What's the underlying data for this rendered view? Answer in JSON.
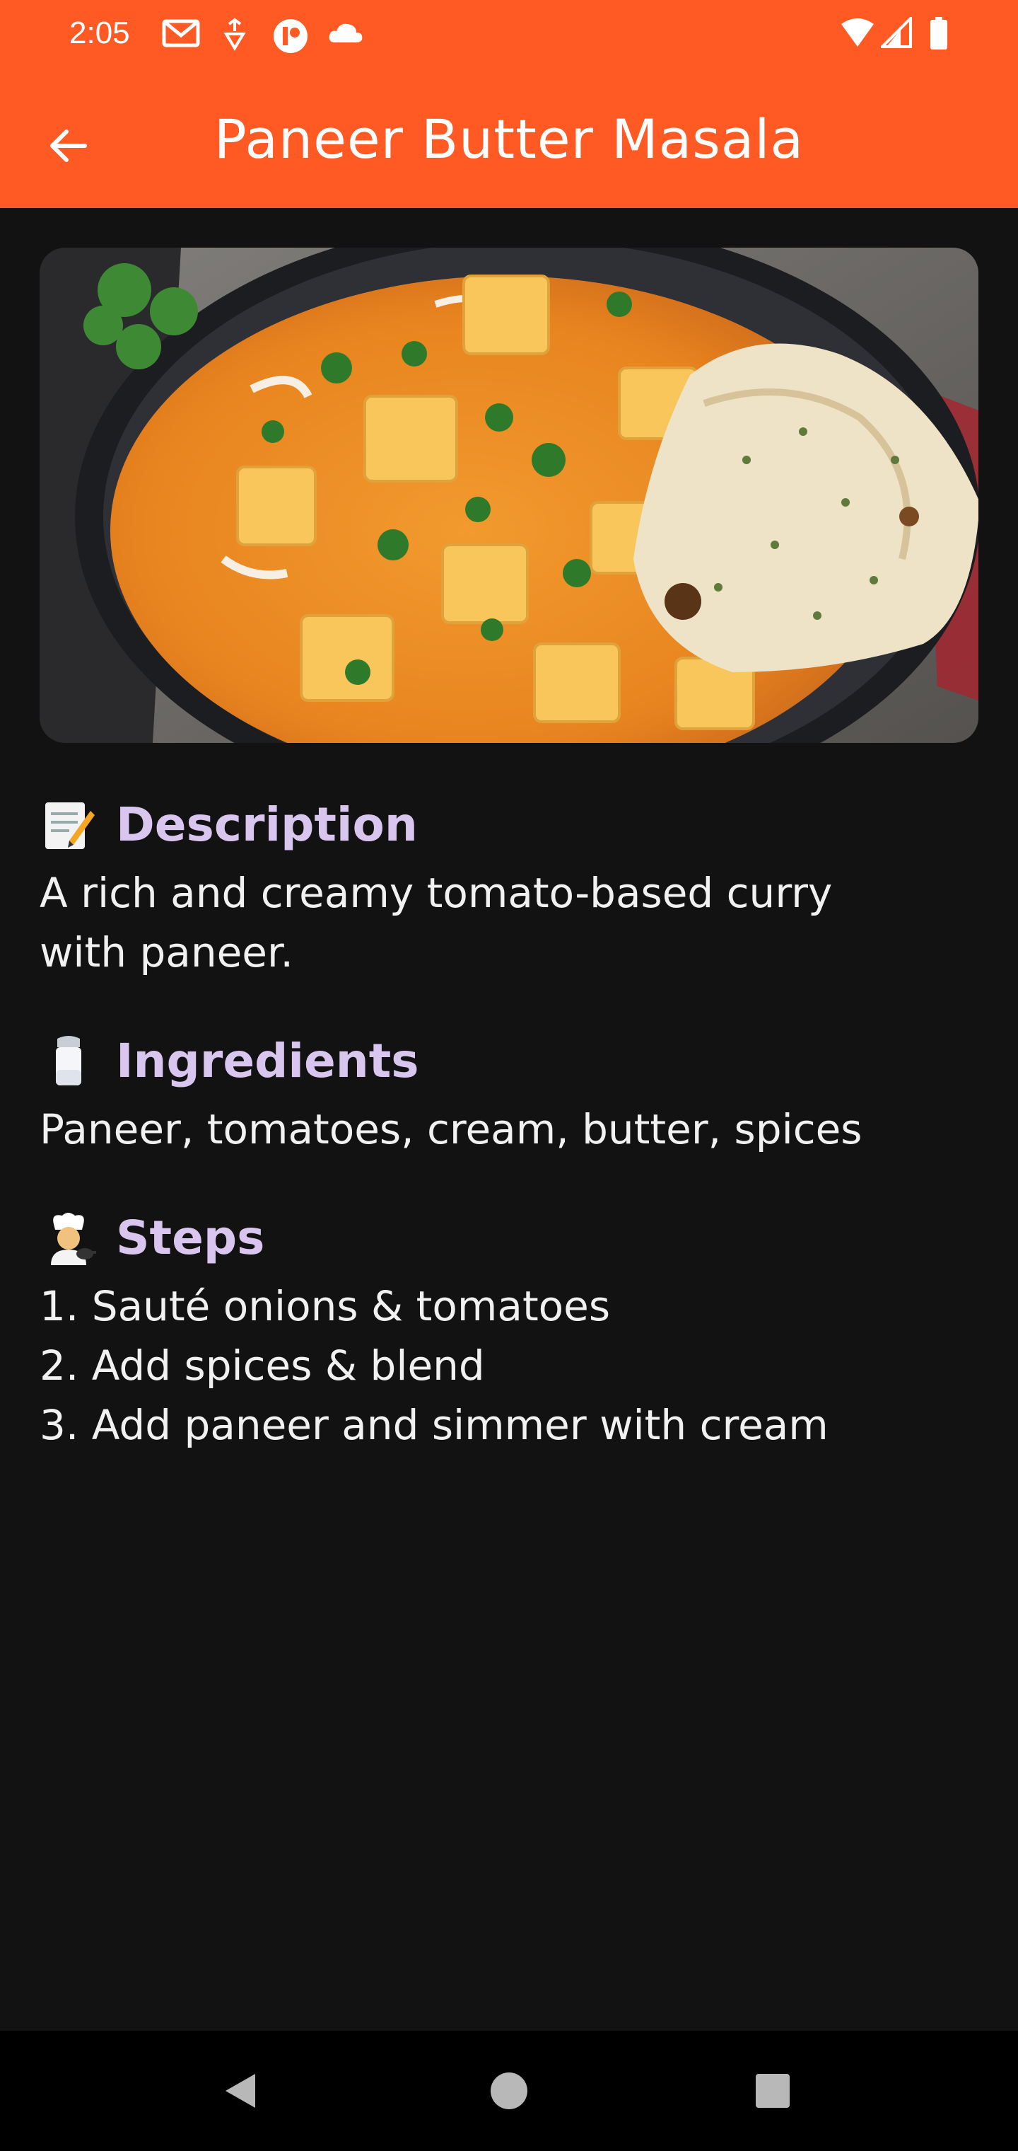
{
  "status_bar": {
    "time": "2:05",
    "left_icons": [
      "gmail-icon",
      "usb-debug-icon",
      "app-notification-icon",
      "cloud-icon"
    ],
    "right_icons": [
      "wifi-icon",
      "signal-icon",
      "battery-icon"
    ]
  },
  "app_bar": {
    "title": "Paneer Butter Masala",
    "back_icon": "arrow-back-icon",
    "color": "#ff5a24"
  },
  "hero_image": {
    "alt": "Paneer Butter Masala"
  },
  "sections": {
    "description": {
      "emoji": "memo",
      "heading": "Description",
      "text": "A rich and creamy tomato-based curry\nwith paneer."
    },
    "ingredients": {
      "emoji": "salt-shaker",
      "heading": "Ingredients",
      "text": "Paneer, tomatoes, cream, butter, spices"
    },
    "steps": {
      "emoji": "cook",
      "heading": "Steps",
      "items": [
        "1. Sauté onions & tomatoes",
        "2. Add spices & blend",
        "3. Add paneer and simmer with cream"
      ]
    }
  },
  "nav_bar": {
    "buttons": [
      "back-triangle-icon",
      "home-circle-icon",
      "recents-square-icon"
    ]
  },
  "colors": {
    "background": "#121212",
    "heading": "#d9c6ee",
    "text": "#f1f1f1"
  }
}
